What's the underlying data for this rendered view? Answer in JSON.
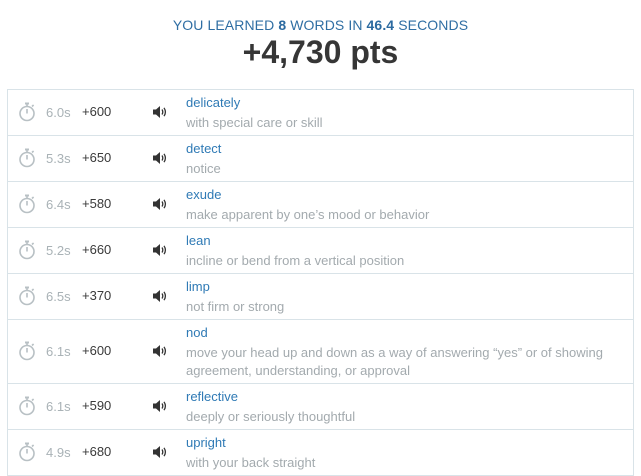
{
  "summary": {
    "prefix": "YOU LEARNED ",
    "word_count": "8",
    "middle": " WORDS IN ",
    "seconds": "46.4",
    "suffix": " SECONDS",
    "points": "+4,730 pts"
  },
  "icons": {
    "timer": "stopwatch-icon",
    "speaker": "speaker-icon"
  },
  "colors": {
    "accent": "#2f7ab5",
    "muted": "#a3aaae",
    "border": "#d9e3e8"
  },
  "words": [
    {
      "time": "6.0s",
      "points": "+600",
      "word": "delicately",
      "definition": "with special care or skill"
    },
    {
      "time": "5.3s",
      "points": "+650",
      "word": "detect",
      "definition": "notice"
    },
    {
      "time": "6.4s",
      "points": "+580",
      "word": "exude",
      "definition": "make apparent by one’s mood or behavior"
    },
    {
      "time": "5.2s",
      "points": "+660",
      "word": "lean",
      "definition": "incline or bend from a vertical position"
    },
    {
      "time": "6.5s",
      "points": "+370",
      "word": "limp",
      "definition": "not firm or strong"
    },
    {
      "time": "6.1s",
      "points": "+600",
      "word": "nod",
      "definition": "move your head up and down as a way of answering “yes” or of showing agreement, understanding, or approval"
    },
    {
      "time": "6.1s",
      "points": "+590",
      "word": "reflective",
      "definition": "deeply or seriously thoughtful"
    },
    {
      "time": "4.9s",
      "points": "+680",
      "word": "upright",
      "definition": "with your back straight"
    }
  ]
}
